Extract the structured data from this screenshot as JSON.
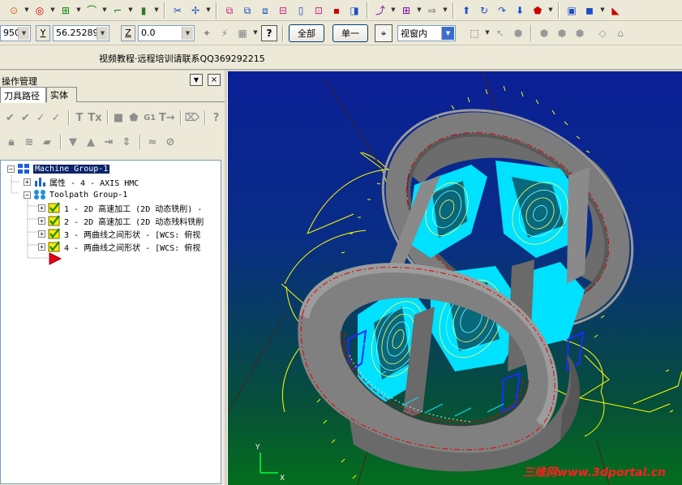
{
  "toolbar2": {
    "x_value": "950",
    "y_label": "Y",
    "y_value": "56.25289",
    "z_label": "Z",
    "z_value": "0.0",
    "all_button": "全部",
    "single_button": "单一",
    "view_select": "视窗内"
  },
  "message": "视频教程·远程培训请联系QQ369292215",
  "panel": {
    "title": "操作管理",
    "tabs": [
      "刀具路径",
      "实体"
    ],
    "icon_row1_g1": "G1"
  },
  "tree": {
    "root": "Machine Group-1",
    "properties": "属性 - 4 - AXIS HMC",
    "group": "Toolpath Group-1",
    "operations": [
      "1 - 2D 高速加工 (2D 动态铣削) -",
      "2 - 2D 高速加工 (2D 动态残料铣削",
      "3 - 两曲线之间形状 - [WCS: 俯视",
      "4 - 两曲线之间形状 - [WCS: 俯视"
    ]
  },
  "viewport": {
    "watermark_cn": "三维网",
    "watermark_url": "www.3dportal.cn"
  },
  "colors": {
    "toolbar_bg": "#ece9d8",
    "viewport_top": "#0a1f96",
    "viewport_bottom": "#046e1c",
    "toolpath_cyan": "#00e5ff",
    "toolpath_yellow": "#ffff00",
    "part_gray": "#808080",
    "watermark": "#ff2020"
  }
}
